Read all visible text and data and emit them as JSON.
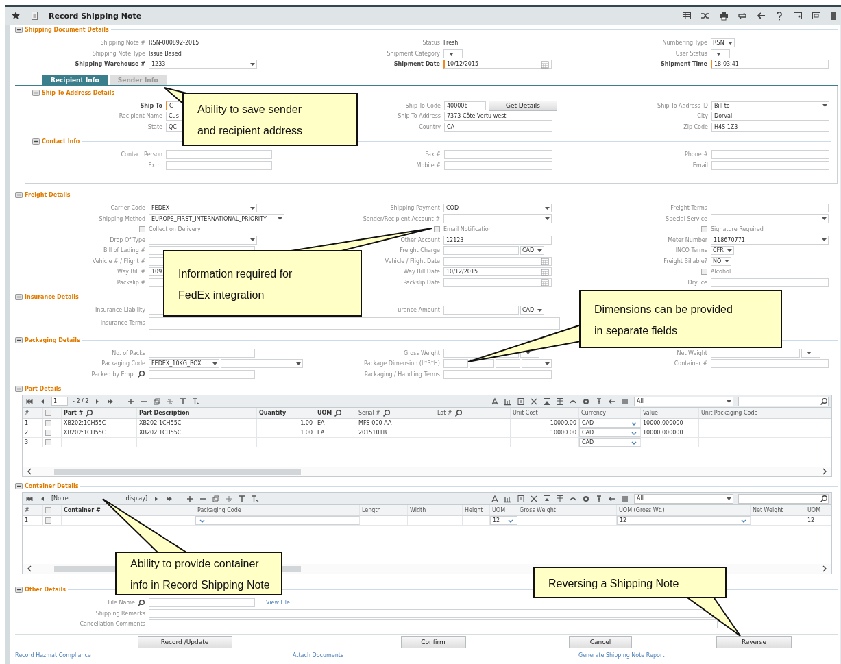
{
  "window": {
    "title": "Record Shipping Note"
  },
  "sections": [
    {
      "kind": "form",
      "title": "Shipping Document Details",
      "expanded": true,
      "columns": [
        [
          {
            "kind": "value",
            "label": "Shipping Note #",
            "value": "RSN-000892-2015"
          },
          {
            "kind": "value",
            "label": "Shipping Note Type",
            "value": "Issue Based"
          },
          {
            "kind": "select",
            "label": "Shipping Warehouse #",
            "value": "1233",
            "required": true
          }
        ],
        [
          {
            "kind": "value",
            "label": "Status",
            "value": "Fresh"
          },
          {
            "kind": "combo",
            "label": "Shipment Category"
          },
          {
            "kind": "date",
            "label": "Shipment Date",
            "value": "10/12/2015",
            "required": true
          }
        ],
        [
          {
            "kind": "combo",
            "label": "Numbering Type",
            "value": "RSN"
          },
          {
            "kind": "combo",
            "label": "User Status"
          },
          {
            "kind": "input",
            "label": "Shipment Time",
            "value": "18:03:41",
            "required": true
          }
        ]
      ]
    },
    {
      "kind": "tabs",
      "tabs": [
        {
          "label": "Recipient Info",
          "selected": true
        },
        {
          "label": "Sender Info",
          "selected": false
        }
      ],
      "sections": [
        {
          "kind": "form",
          "title": "Ship To Address Details",
          "expanded": true,
          "columns": [
            [
              {
                "kind": "input",
                "label": "Ship To",
                "value": "C",
                "required": true
              },
              {
                "kind": "input",
                "label": "Recipient Name",
                "value": "Cus"
              },
              {
                "kind": "input",
                "label": "State",
                "value": "QC"
              }
            ],
            [
              {
                "kind": "input-button",
                "label": "Ship To Code",
                "value": "400006",
                "button": "Get Details"
              },
              {
                "kind": "input",
                "label": "Ship To Address",
                "value": "7373 Côte-Vertu west"
              },
              {
                "kind": "input",
                "label": "Country",
                "value": "CA"
              }
            ],
            [
              {
                "kind": "select",
                "label": "Ship To Address ID",
                "value": "Bill to"
              },
              {
                "kind": "input",
                "label": "City",
                "value": "Dorval"
              },
              {
                "kind": "input",
                "label": "Zip Code",
                "value": "H4S 1Z3"
              }
            ]
          ]
        },
        {
          "kind": "form",
          "title": "Contact Info",
          "expanded": true,
          "columns": [
            [
              {
                "kind": "input",
                "label": "Contact Person"
              },
              {
                "kind": "input",
                "label": "Extn."
              }
            ],
            [
              {
                "kind": "input",
                "label": "Fax #"
              },
              {
                "kind": "input",
                "label": "Mobile #"
              }
            ],
            [
              {
                "kind": "input",
                "label": "Phone #"
              },
              {
                "kind": "input",
                "label": "Email"
              }
            ]
          ]
        }
      ]
    },
    {
      "kind": "form",
      "title": "Freight Details",
      "expanded": true,
      "columns": [
        [
          {
            "kind": "select",
            "label": "Carrier Code",
            "value": "FEDEX"
          },
          {
            "kind": "select",
            "label": "Shipping Method",
            "value": "EUROPE_FIRST_INTERNATIONAL_PRIORITY"
          },
          {
            "kind": "check",
            "label": "Collect on Delivery",
            "checked": false
          },
          {
            "kind": "select",
            "label": "Drop Of Type"
          },
          {
            "kind": "input",
            "label": "Bill of Lading #"
          },
          {
            "kind": "input",
            "label": "Vehicle # / Flight #"
          },
          {
            "kind": "input",
            "label": "Way Bill #",
            "value": "109"
          },
          {
            "kind": "input",
            "label": "Packslip #"
          }
        ],
        [
          {
            "kind": "select",
            "label": "Shipping Payment",
            "value": "COD"
          },
          {
            "kind": "select",
            "label": "Sender/Recipient Account #"
          },
          {
            "kind": "check",
            "label": "Email Notification",
            "checked": false
          },
          {
            "kind": "input",
            "label": "Other Account",
            "value": "12123"
          },
          {
            "kind": "amount",
            "label": "Freight Charge",
            "unit": "CAD"
          },
          {
            "kind": "date",
            "label": "Vehicle / Flight Date"
          },
          {
            "kind": "date",
            "label": "Way Bill Date",
            "value": "10/12/2015"
          },
          {
            "kind": "date",
            "label": "Packslip Date"
          }
        ],
        [
          {
            "kind": "input",
            "label": "Freight Terms"
          },
          {
            "kind": "select",
            "label": "Special Service"
          },
          {
            "kind": "check",
            "label": "Signature Required",
            "checked": false
          },
          {
            "kind": "select",
            "label": "Meter Number",
            "value": "118670771"
          },
          {
            "kind": "combo",
            "label": "INCO Terms",
            "value": "CFR"
          },
          {
            "kind": "combo",
            "label": "Freight Billable?",
            "value": "NO"
          },
          {
            "kind": "check",
            "label": "Alcohol",
            "checked": false
          },
          {
            "kind": "input",
            "label": "Dry Ice"
          }
        ]
      ]
    },
    {
      "kind": "form",
      "title": "Insurance Details",
      "expanded": true,
      "columns": [
        [
          {
            "kind": "input",
            "label": "Insurance Liability"
          },
          {
            "kind": "textarea",
            "label": "Insurance Terms"
          }
        ],
        [
          {
            "kind": "amount",
            "label": "urance Amount",
            "unit": "CAD"
          }
        ],
        []
      ]
    },
    {
      "kind": "form",
      "title": "Packaging Details",
      "expanded": true,
      "columns": [
        [
          {
            "kind": "input",
            "label": "No. of Packs"
          },
          {
            "kind": "dual",
            "label": "Packaging Code",
            "value": "FEDEX_10KG_BOX"
          },
          {
            "kind": "lookup",
            "label": "Packed by Emp."
          }
        ],
        [
          {
            "kind": "amount",
            "label": "Gross Weight"
          },
          {
            "kind": "dims",
            "label": "Package Dimension (L*B*H)"
          },
          {
            "kind": "input",
            "label": "Packaging / Handling Terms"
          }
        ],
        [
          {
            "kind": "amount",
            "label": "Net Weight"
          },
          {
            "kind": "input",
            "label": "Container #"
          }
        ]
      ]
    },
    {
      "kind": "grid",
      "title": "Part Details",
      "expanded": true,
      "page": "1",
      "pages": "- 2 / 2",
      "filter": "All",
      "all_checked": false,
      "columns": [
        {
          "label": "#",
          "kind": "num",
          "required": false
        },
        {
          "label": "Part #",
          "kind": "text",
          "required": true,
          "lookup": true
        },
        {
          "label": "Part Description",
          "kind": "text",
          "required": true
        },
        {
          "label": "Quantity",
          "kind": "number",
          "required": true
        },
        {
          "label": "UOM",
          "kind": "text",
          "required": true,
          "lookup": true
        },
        {
          "label": "Serial #",
          "kind": "text",
          "required": false,
          "lookup": true
        },
        {
          "label": "Lot #",
          "kind": "text",
          "required": false,
          "lookup": true
        },
        {
          "label": "Unit Cost",
          "kind": "number",
          "required": false
        },
        {
          "label": "Currency",
          "kind": "combo",
          "required": false
        },
        {
          "label": "Value",
          "kind": "text",
          "required": false
        },
        {
          "label": "Unit Packaging Code",
          "kind": "text",
          "required": false
        }
      ],
      "rows": [
        {
          "checked": false,
          "cells": [
            "1",
            "XB202:1CH55C",
            "XB202:1CH55C",
            "1.00",
            "EA",
            "MFS-000-AA",
            "",
            "10000.00",
            "CAD",
            "10000.000000",
            ""
          ]
        },
        {
          "checked": false,
          "cells": [
            "2",
            "XB202:1CH55C",
            "XB202:1CH55C",
            "1.00",
            "EA",
            "2015101B",
            "",
            "10000.00",
            "CAD",
            "10000.000000",
            ""
          ]
        },
        {
          "checked": false,
          "cells": [
            "3",
            "",
            "",
            "",
            "",
            "",
            "",
            "",
            "CAD",
            "",
            ""
          ]
        }
      ]
    },
    {
      "kind": "grid",
      "title": "Container Details",
      "expanded": true,
      "status": [
        "[No re",
        "display]"
      ],
      "filter": "All",
      "all_checked": false,
      "columns": [
        {
          "label": "#",
          "kind": "num",
          "required": false
        },
        {
          "label": "Container #",
          "kind": "text",
          "required": true
        },
        {
          "label": "Packaging Code",
          "kind": "combo",
          "required": false
        },
        {
          "label": "Length",
          "kind": "text",
          "required": false
        },
        {
          "label": "Width",
          "kind": "text",
          "required": false
        },
        {
          "label": "Height",
          "kind": "text",
          "required": false
        },
        {
          "label": "UOM",
          "kind": "combo",
          "required": false
        },
        {
          "label": "Gross Weight",
          "kind": "text",
          "required": false
        },
        {
          "label": "UOM (Gross Wt.)",
          "kind": "combo",
          "required": false
        },
        {
          "label": "Net Weight",
          "kind": "text",
          "required": false
        },
        {
          "label": "UOM",
          "kind": "text",
          "required": false
        }
      ],
      "rows": [
        {
          "checked": false,
          "cells": [
            "1",
            "",
            "",
            "",
            "",
            "",
            "12",
            "",
            "12",
            "",
            "12"
          ]
        }
      ]
    },
    {
      "kind": "form",
      "title": "Other Details",
      "expanded": true,
      "columns": [
        [
          {
            "kind": "lookup-link",
            "label": "File Name",
            "link": "View File"
          },
          {
            "kind": "long",
            "label": "Shipping Remarks"
          },
          {
            "kind": "long",
            "label": "Cancellation Comments"
          }
        ],
        [],
        []
      ]
    }
  ],
  "buttons": [
    "Record /Update",
    "Confirm",
    "Cancel",
    "Reverse"
  ],
  "links": [
    "Record Hazmat Compliance",
    "Attach Documents",
    "Generate Shipping Note Report"
  ],
  "callouts": [
    {
      "text": "Ability to save sender and recipient address"
    },
    {
      "text": "Information required for FedEx integration"
    },
    {
      "text": "Dimensions can be provided in separate fields"
    },
    {
      "text": "Ability to provide container info in Record Shipping Note"
    },
    {
      "text": "Reversing a Shipping Note"
    }
  ]
}
